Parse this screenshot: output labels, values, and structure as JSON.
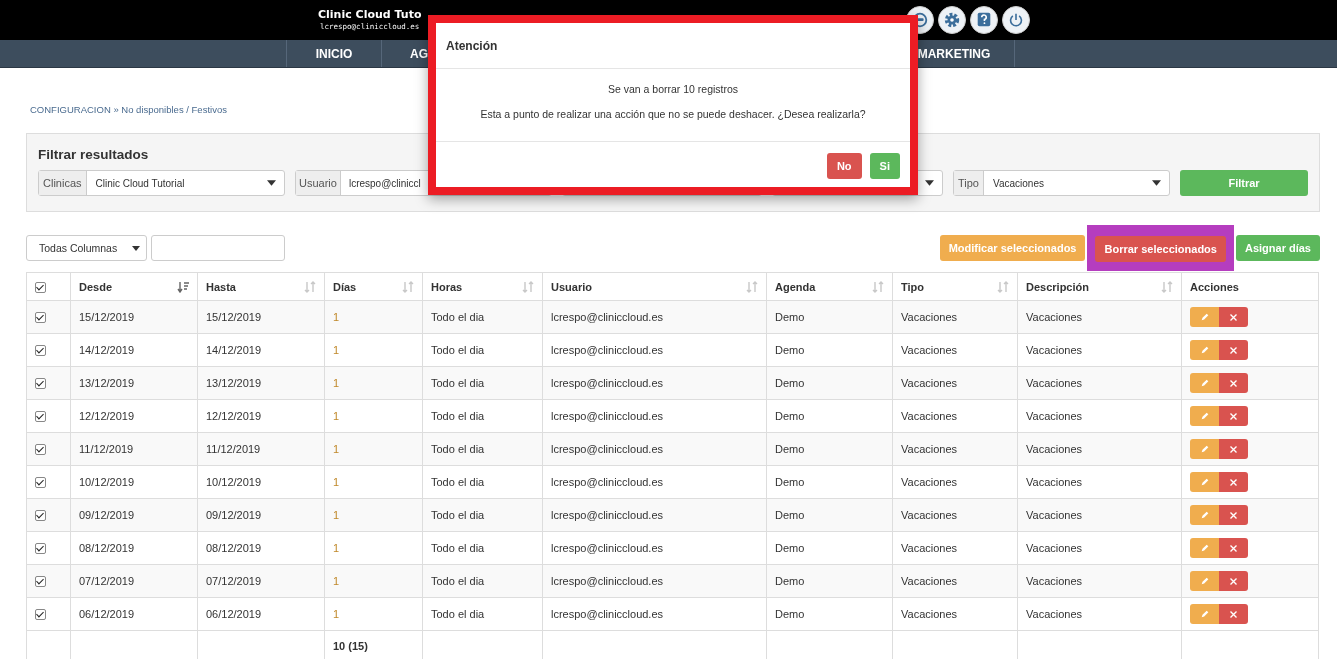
{
  "header": {
    "title": "Clinic Cloud Tuto",
    "user": "lcrespo@cliniccloud.es"
  },
  "nav_left": [
    "INICIO",
    "AG"
  ],
  "nav_right": [
    "MARKETING"
  ],
  "breadcrumb": "CONFIGURACION » No disponibles / Festivos",
  "filter": {
    "title": "Filtrar resultados",
    "button": "Filtrar",
    "fields": [
      {
        "kind": "select",
        "label": "Clinicas",
        "value": "Clinic Cloud Tutorial"
      },
      {
        "kind": "input",
        "label": "Usuario",
        "value": "lcrespo@cliniccl"
      },
      {
        "kind": "covered"
      },
      {
        "kind": "covered_select"
      },
      {
        "kind": "select",
        "label": "Tipo",
        "value": "Vacaciones"
      }
    ]
  },
  "toolbar": {
    "column_select": "Todas Columnas",
    "actions": [
      {
        "label": "Modificar seleccionados",
        "kind": "warning",
        "highlighted": false
      },
      {
        "label": "Borrar seleccionados",
        "kind": "danger",
        "highlighted": true
      },
      {
        "label": "Asignar días",
        "kind": "success",
        "highlighted": false
      }
    ]
  },
  "table": {
    "all_checked": true,
    "columns": [
      {
        "label": "Desde",
        "sorted": true
      },
      {
        "label": "Hasta",
        "sorted": false
      },
      {
        "label": "Días",
        "sorted": false
      },
      {
        "label": "Horas",
        "sorted": false
      },
      {
        "label": "Usuario",
        "sorted": false
      },
      {
        "label": "Agenda",
        "sorted": false
      },
      {
        "label": "Tipo",
        "sorted": false
      },
      {
        "label": "Descripción",
        "sorted": false
      },
      {
        "label": "Acciones"
      }
    ],
    "rows": [
      {
        "checked": true,
        "cells": [
          "15/12/2019",
          "15/12/2019",
          "1",
          "Todo el dia",
          "lcrespo@cliniccloud.es",
          "Demo",
          "Vacaciones",
          "Vacaciones"
        ]
      },
      {
        "checked": true,
        "cells": [
          "14/12/2019",
          "14/12/2019",
          "1",
          "Todo el dia",
          "lcrespo@cliniccloud.es",
          "Demo",
          "Vacaciones",
          "Vacaciones"
        ]
      },
      {
        "checked": true,
        "cells": [
          "13/12/2019",
          "13/12/2019",
          "1",
          "Todo el dia",
          "lcrespo@cliniccloud.es",
          "Demo",
          "Vacaciones",
          "Vacaciones"
        ]
      },
      {
        "checked": true,
        "cells": [
          "12/12/2019",
          "12/12/2019",
          "1",
          "Todo el dia",
          "lcrespo@cliniccloud.es",
          "Demo",
          "Vacaciones",
          "Vacaciones"
        ]
      },
      {
        "checked": true,
        "cells": [
          "11/12/2019",
          "11/12/2019",
          "1",
          "Todo el dia",
          "lcrespo@cliniccloud.es",
          "Demo",
          "Vacaciones",
          "Vacaciones"
        ]
      },
      {
        "checked": true,
        "cells": [
          "10/12/2019",
          "10/12/2019",
          "1",
          "Todo el dia",
          "lcrespo@cliniccloud.es",
          "Demo",
          "Vacaciones",
          "Vacaciones"
        ]
      },
      {
        "checked": true,
        "cells": [
          "09/12/2019",
          "09/12/2019",
          "1",
          "Todo el dia",
          "lcrespo@cliniccloud.es",
          "Demo",
          "Vacaciones",
          "Vacaciones"
        ]
      },
      {
        "checked": true,
        "cells": [
          "08/12/2019",
          "08/12/2019",
          "1",
          "Todo el dia",
          "lcrespo@cliniccloud.es",
          "Demo",
          "Vacaciones",
          "Vacaciones"
        ]
      },
      {
        "checked": true,
        "cells": [
          "07/12/2019",
          "07/12/2019",
          "1",
          "Todo el dia",
          "lcrespo@cliniccloud.es",
          "Demo",
          "Vacaciones",
          "Vacaciones"
        ]
      },
      {
        "checked": true,
        "cells": [
          "06/12/2019",
          "06/12/2019",
          "1",
          "Todo el dia",
          "lcrespo@cliniccloud.es",
          "Demo",
          "Vacaciones",
          "Vacaciones"
        ]
      }
    ],
    "footer_days": "10 (15)"
  },
  "dialog": {
    "title": "Atención",
    "message": "Se van a borrar 10 registros",
    "question": "Esta a punto de realizar una acción que no se puede deshacer. ¿Desea realizarla?",
    "buttons": [
      {
        "label": "No",
        "kind": "danger"
      },
      {
        "label": "Si",
        "kind": "success"
      }
    ]
  }
}
